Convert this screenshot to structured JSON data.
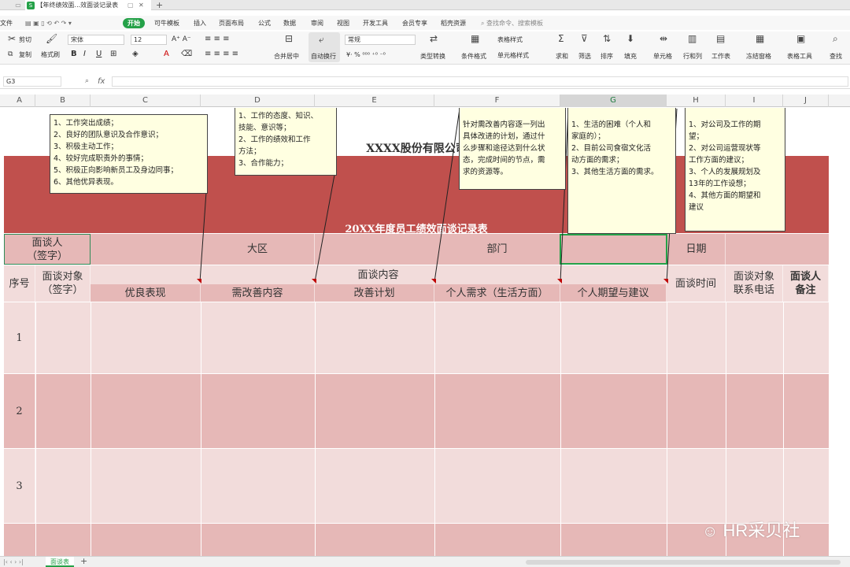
{
  "tabs": [
    {
      "label": "【年终绩效面...效面谈记录表",
      "icon": "S"
    }
  ],
  "menus": [
    "文件",
    "开始",
    "可牛模板",
    "插入",
    "页面布局",
    "公式",
    "数据",
    "审阅",
    "视图",
    "开发工具",
    "会员专享",
    "稻壳资源"
  ],
  "search_placeholder": "查找命令、搜索模板",
  "ribbon": {
    "cut": "剪切",
    "copy": "复制",
    "format_painter": "格式刷",
    "font": "宋体",
    "font_size": "12",
    "merge": "合并居中",
    "wrap": "自动换行",
    "number_format": "常规",
    "type_convert": "类型转换",
    "cond_format": "条件格式",
    "table_style": "表格样式",
    "cell_style": "单元格样式",
    "sum": "求和",
    "filter": "筛选",
    "sort": "排序",
    "fill": "填充",
    "cells": "单元格",
    "rows_cols": "行和列",
    "worksheet": "工作表",
    "freeze": "冻结窗格",
    "table_tools": "表格工具",
    "find": "查找"
  },
  "formula_bar": {
    "name_box": "G3",
    "fx": "fx"
  },
  "columns": [
    "A",
    "B",
    "C",
    "D",
    "E",
    "F",
    "G",
    "H",
    "I",
    "J"
  ],
  "sheet": {
    "company": "XXXX股份有限公司",
    "title": "20XX年度员工绩效面谈记录表",
    "interviewer": "面谈人\n（签字）",
    "region": "大区",
    "department": "部门",
    "date": "日期",
    "seq": "序号",
    "interviewee": "面谈对象\n（签字）",
    "content": "面谈内容",
    "good": "优良表现",
    "improve": "需改善内容",
    "plan": "改善计划",
    "need": "个人需求（生活方面）",
    "expect": "个人期望与建议",
    "time": "面谈时间",
    "phone": "面谈对象\n联系电话",
    "remark": "面谈人\n备注",
    "rows": [
      "1",
      "2",
      "3"
    ]
  },
  "comments": {
    "c1": [
      "1、工作突出成绩；",
      "2、良好的团队意识及合作意识；",
      "3、积极主动工作；",
      "4、较好完成职责外的事情；",
      "5、积极正向影响新员工及身边同事；",
      "6、其他优异表现。"
    ],
    "c2": [
      "1、工作的态度、知识、",
      "技能、意识等；",
      "2、工作的绩效和工作",
      "方法；",
      "3、合作能力；"
    ],
    "c3": [
      "针对需改善内容逐一列出",
      "具体改进的计划，通过什",
      "么步骤和途径达到什么状",
      "态，完成时间的节点，需",
      "求的资源等。"
    ],
    "c4": [
      "1、生活的困难（个人和",
      "家庭的）；",
      "2、目前公司食宿文化活",
      "动方面的需求；",
      "3、其他生活方面的需求。"
    ],
    "c5": [
      "1、对公司及工作的期",
      "望；",
      "2、对公司运营现状等",
      "工作方面的建议；",
      "3、个人的发展规划及",
      "13年的工作设想；",
      "4、其他方面的期望和",
      "建议"
    ]
  },
  "sheet_tab": "面谈表",
  "watermark": "HR采贝社",
  "colors": {
    "dark_red": "#c0504d",
    "pink": "#e6b8b7",
    "light_pink": "#f2dcdb",
    "green": "#24a148",
    "note": "#ffffe1"
  }
}
